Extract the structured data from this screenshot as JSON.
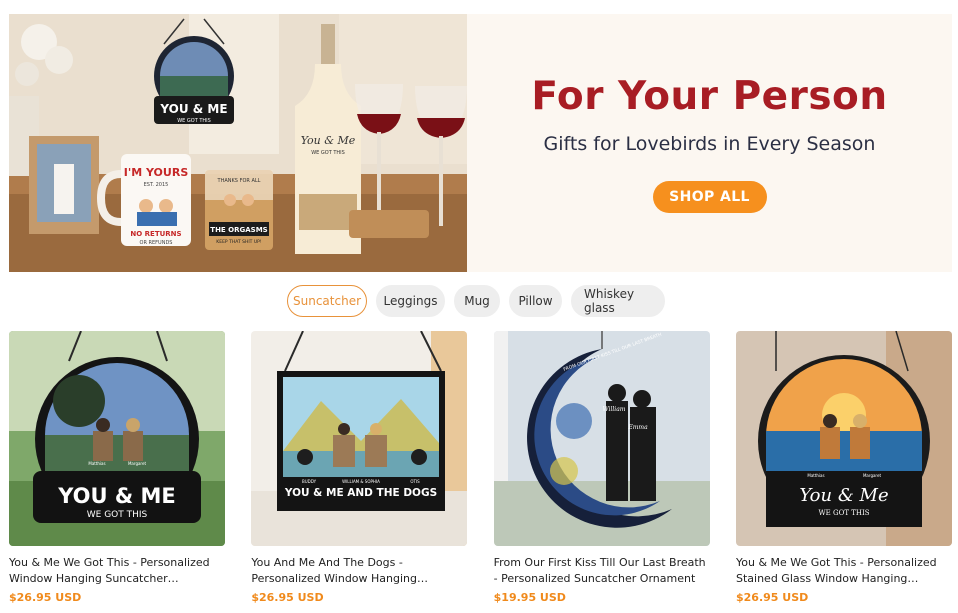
{
  "hero": {
    "title": "For Your Person",
    "subtitle": "Gifts for Lovebirds in Every Season",
    "button_label": "SHOP ALL",
    "image_texts": {
      "ornament_main": "YOU & ME",
      "ornament_sub": "WE GOT THIS",
      "mug_line1": "I'M YOURS",
      "mug_line2": "EST. 2015",
      "mug_line3": "NO RETURNS",
      "mug_line4": "OR REFUNDS",
      "glass_line1": "THANKS FOR ALL",
      "glass_line2": "THE ORGASMS",
      "glass_line3": "KEEP THAT SHIT UP!",
      "bottle_line1": "You & Me",
      "bottle_line2": "WE GOT THIS"
    }
  },
  "filters": [
    {
      "label": "Suncatcher",
      "active": true
    },
    {
      "label": "Leggings",
      "active": false
    },
    {
      "label": "Mug",
      "active": false
    },
    {
      "label": "Pillow",
      "active": false
    },
    {
      "label": "Whiskey glass",
      "active": false
    }
  ],
  "products": [
    {
      "title": "You & Me We Got This - Personalized Window Hanging Suncatcher…",
      "price": "$26.95 USD",
      "image_texts": {
        "main": "YOU & ME",
        "sub": "WE GOT THIS",
        "name1": "Matthias",
        "name2": "Margaret"
      }
    },
    {
      "title": "You And Me And The Dogs - Personalized Window Hanging…",
      "price": "$26.95 USD",
      "image_texts": {
        "main": "YOU & ME AND THE DOGS",
        "name1": "BUDDY",
        "name2": "WILLIAM & SOPHIA",
        "name3": "OTIS"
      }
    },
    {
      "title": "From Our First Kiss Till Our Last Breath - Personalized Suncatcher Ornament",
      "price": "$19.95 USD",
      "image_texts": {
        "arc": "FROM OUR FIRST KISS TILL OUR LAST BREATH",
        "name1": "William",
        "name2": "Emma"
      }
    },
    {
      "title": "You & Me We Got This - Personalized Stained Glass Window Hanging…",
      "price": "$26.95 USD",
      "image_texts": {
        "main": "You & Me",
        "sub": "WE GOT THIS",
        "name1": "Matthias",
        "name2": "Margaret"
      }
    }
  ],
  "colors": {
    "brand_red": "#a81d24",
    "accent_orange": "#f6901e",
    "price_orange": "#f08a1c"
  }
}
